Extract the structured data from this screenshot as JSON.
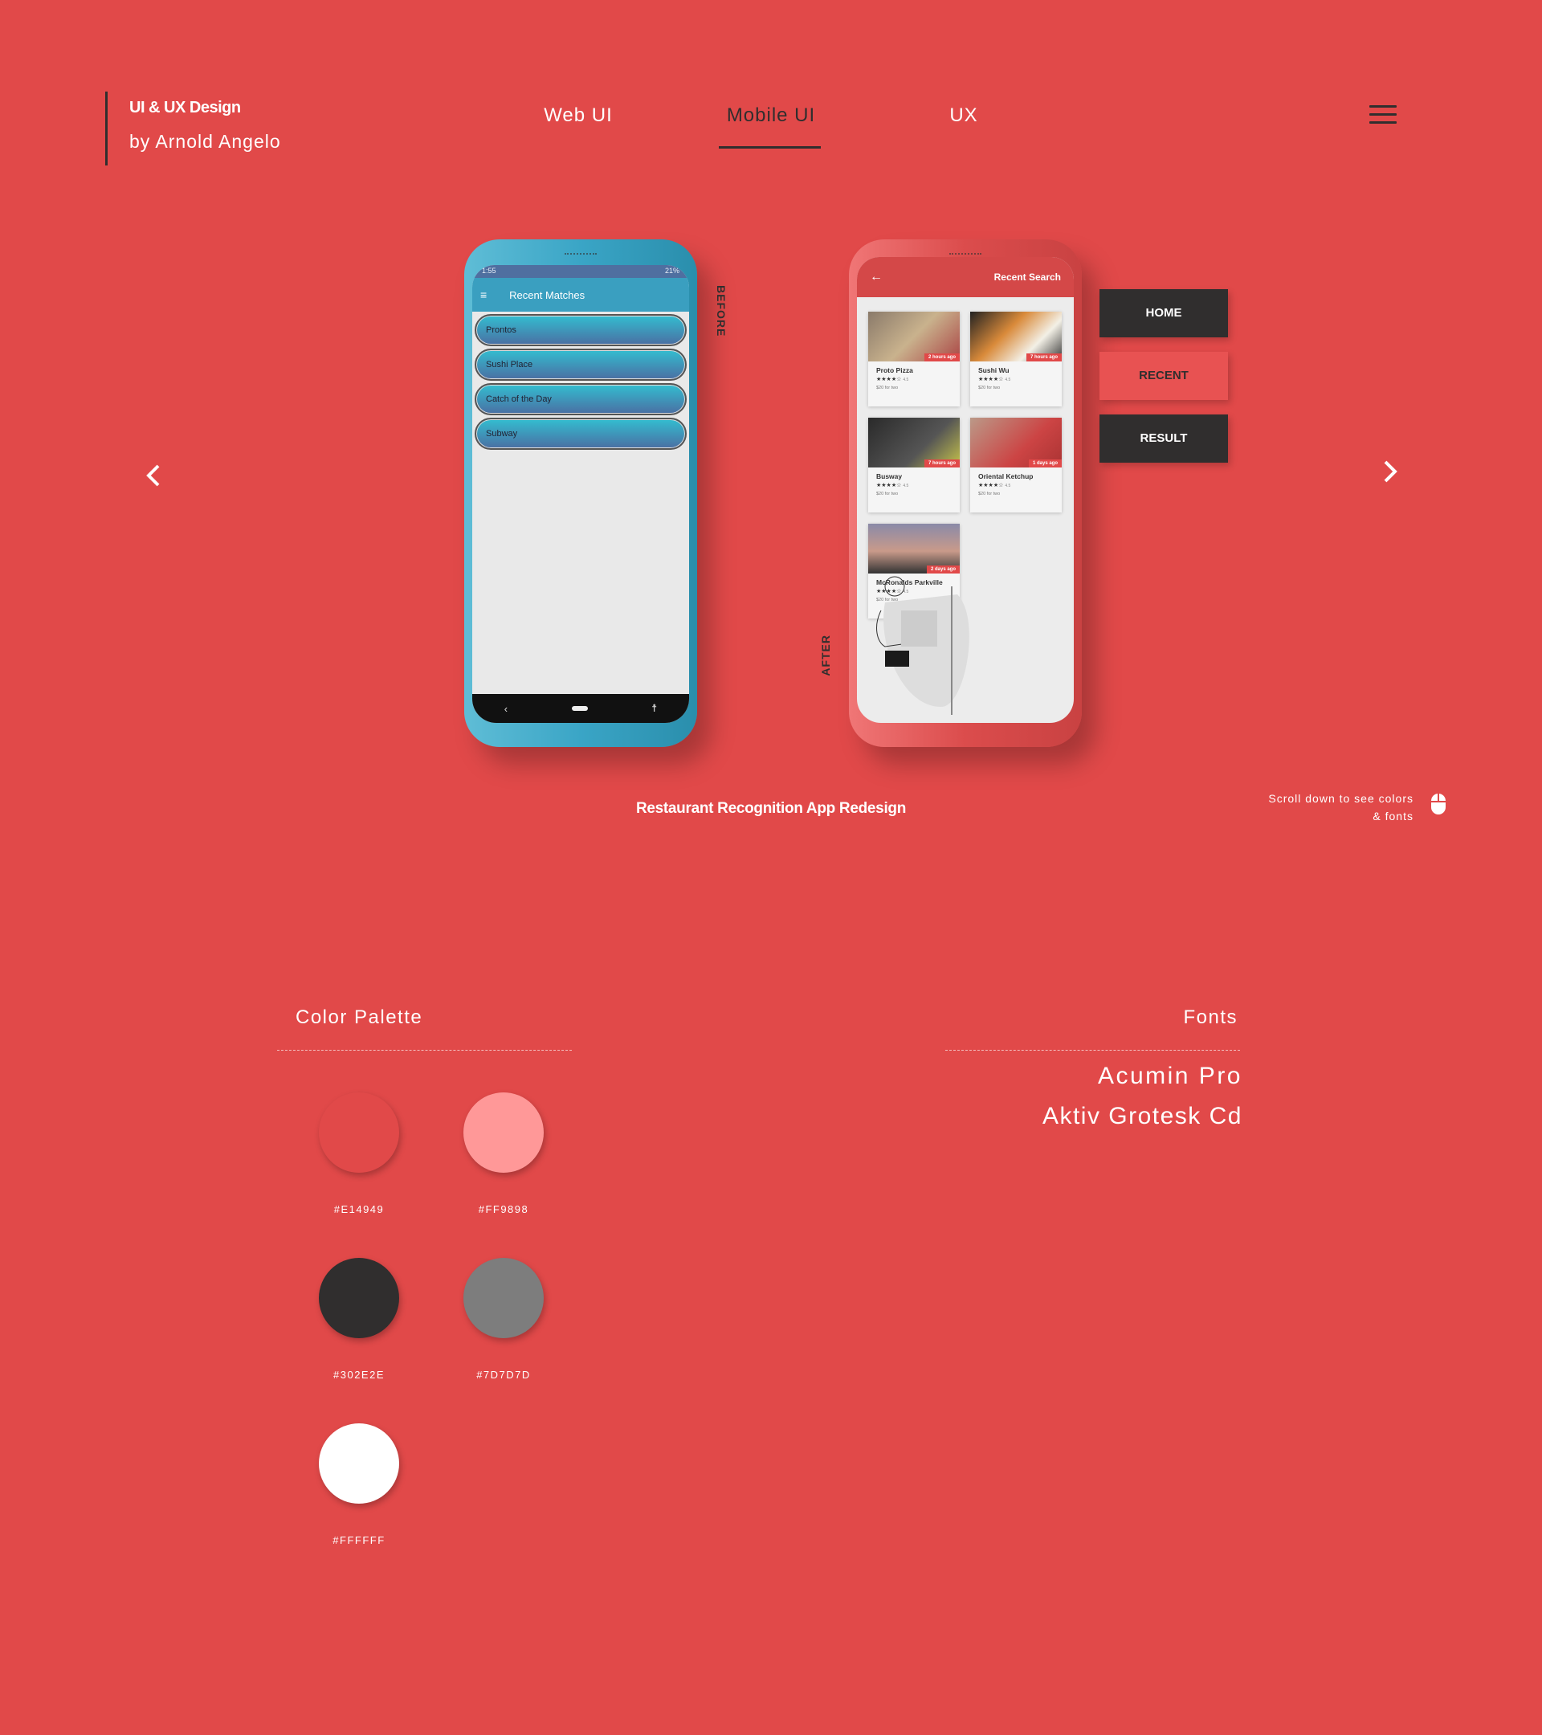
{
  "header": {
    "title": "UI & UX Design",
    "subtitle": "by Arnold Angelo",
    "nav": [
      {
        "label": "Web UI",
        "active": false
      },
      {
        "label": "Mobile UI",
        "active": true
      },
      {
        "label": "UX",
        "active": false
      }
    ],
    "menu_icon": "hamburger-icon"
  },
  "carousel": {
    "prev_icon": "chevron-left-icon",
    "next_icon": "chevron-right-icon",
    "caption": "Restaurant Recognition App Redesign",
    "before": {
      "label": "BEFORE",
      "status_time": "1:55",
      "status_battery": "21%",
      "app_title": "Recent Matches",
      "items": [
        "Prontos",
        "Sushi Place",
        "Catch of the Day",
        "Subway"
      ],
      "accent": "#3AA5C6"
    },
    "after": {
      "label": "AFTER",
      "app_title": "Recent Search",
      "cards": [
        {
          "name": "Proto Pizza",
          "time": "2 hours ago",
          "rating": "4.5",
          "price": "$20 for two"
        },
        {
          "name": "Sushi Wu",
          "time": "7 hours ago",
          "rating": "4.5",
          "price": "$20 for two"
        },
        {
          "name": "Busway",
          "time": "7 hours ago",
          "rating": "4.5",
          "price": "$20 for two"
        },
        {
          "name": "Oriental Ketchup",
          "time": "1 days ago",
          "rating": "4.5",
          "price": "$20 for two"
        },
        {
          "name": "McRonalds Parkville",
          "time": "2 days ago",
          "rating": "4.5",
          "price": "$20 for two"
        }
      ]
    },
    "screen_buttons": [
      {
        "label": "HOME",
        "active": false
      },
      {
        "label": "RECENT",
        "active": true
      },
      {
        "label": "RESULT",
        "active": false
      }
    ]
  },
  "scroll_hint": {
    "line1": "Scroll down to see colors",
    "line2": "& fonts",
    "icon": "mouse-icon"
  },
  "palette": {
    "title": "Color Palette",
    "colors": [
      "#E14949",
      "#FF9898",
      "#302E2E",
      "#7D7D7D",
      "#FFFFFF"
    ]
  },
  "fonts": {
    "title": "Fonts",
    "items": [
      "Acumin Pro",
      "Aktiv Grotesk Cd"
    ]
  }
}
